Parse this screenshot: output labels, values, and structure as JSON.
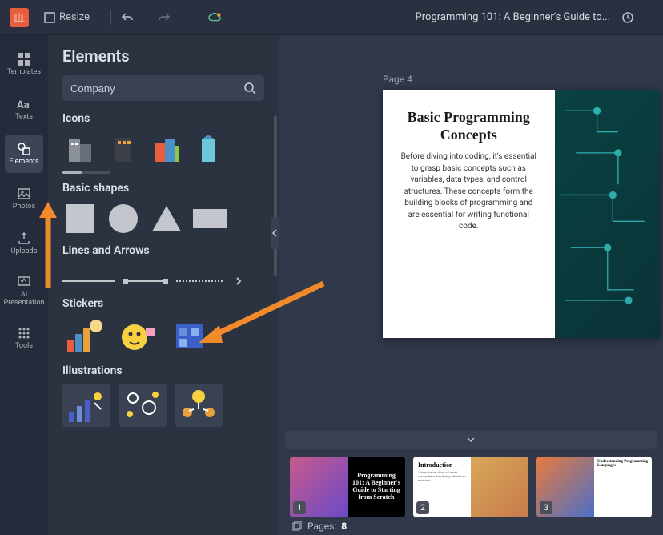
{
  "topbar": {
    "resize_label": "Resize",
    "title": "Programming 101: A Beginner's Guide to..."
  },
  "leftrail": {
    "templates": "Templates",
    "texts": "Texts",
    "elements": "Elements",
    "photos": "Photos",
    "uploads": "Uploads",
    "ai_presentation": "AI\nPresentation",
    "tools": "Tools"
  },
  "panel": {
    "title": "Elements",
    "search_value": "Company",
    "sections": {
      "icons": "Icons",
      "basic_shapes": "Basic shapes",
      "lines_arrows": "Lines and Arrows",
      "stickers": "Stickers",
      "illustrations": "Illustrations"
    }
  },
  "canvas": {
    "page_label": "Page 4",
    "slide_title": "Basic Programming Concepts",
    "slide_body": "Before diving into coding, it's essential to grasp basic concepts such as variables, data types, and control structures. These concepts form the building blocks of programming and are essential for writing functional code."
  },
  "thumbs": {
    "t1": {
      "num": "1",
      "title": "Programming 101: A Beginner's Guide to Starting from Scratch"
    },
    "t2": {
      "num": "2",
      "title": "Introduction"
    },
    "t3": {
      "num": "3",
      "title": "Understanding Programming Languages"
    }
  },
  "footer": {
    "pages_label": "Pages:",
    "pages_count": "8"
  }
}
